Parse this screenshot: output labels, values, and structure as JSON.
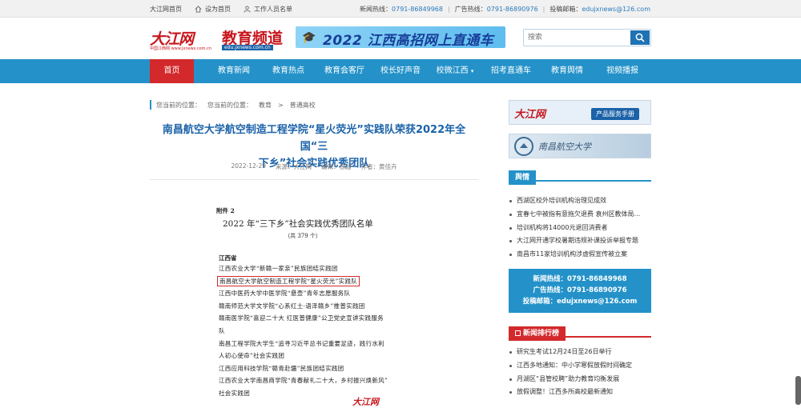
{
  "topbar": {
    "home": "大江网首页",
    "set_home": "设为首页",
    "staff": "工作人员名单",
    "news_label": "新闻热线：",
    "news_phone": "0791-86849968",
    "ad_label": "广告热线：",
    "ad_phone": "0791-86890976",
    "email_label": "投稿邮箱：",
    "email": "edujxnews@126.com"
  },
  "header": {
    "logo_text": "大江网",
    "logo_sub": "中国江西网 www.jxnews.com.cn",
    "section_logo": "教育频道",
    "section_url": "edu.jxnews.com.cn",
    "banner_text": "2022 江西高招网上直通车",
    "search_placeholder": "搜索"
  },
  "nav": {
    "items": [
      "首页",
      "教育新闻",
      "教育热点",
      "教育会客厅",
      "校长好声音",
      "校微江西",
      "招考直通车",
      "教育舆情",
      "视频播报"
    ]
  },
  "crumb": {
    "label": "您当前的位置：",
    "label2": "您当前的位置：",
    "c1": "教育",
    "arrow": ">",
    "c2": "普通高校"
  },
  "article": {
    "title_l1": "南昌航空大学航空制造工程学院“星火荧光”实践队荣获2022年全国“三",
    "title_l2": "下乡”社会实践优秀团队",
    "date": "2022-12-29",
    "source": "来源：大江网",
    "editor": "编辑：徐超",
    "author": "作者：黄佳卉"
  },
  "doc": {
    "attachment": "附件 2",
    "title": "2022 年“三下乡”社会实践优秀团队名单",
    "subtitle": "（共 379 个）",
    "province": "江西省",
    "lines": [
      "江西农业大学“新赣一家亲”民族团结实践团",
      "南昌航空大学航空制造工程学院“星火荧光”实践队",
      "江西中医药大学中医学院“悬壶”青年志愿服务队",
      "赣南师范大学文学院“心系红土·语泽赣乡”推普实践团",
      "赣南医学院“喜迎二十大 红医普健康”公卫党史宣讲实践服务",
      "队",
      "南昌工程学院大学生“追寻习近平总书记重要足迹，践行水利",
      "人初心使命”社会实践团",
      "江西应用科技学院“赣青赴疆”民族团结实践团",
      "江西农业大学南昌商学院“青春献礼二十大，乡村振兴焕新风”",
      "社会实践团"
    ],
    "watermark": "大江网"
  },
  "sidebar": {
    "ad1_logo": "大江网",
    "ad1_button": "产品服务手册",
    "ad2_text": "南昌航空大学",
    "section1": "舆情",
    "list1": [
      "西湖区校外培训机构治理见成效",
      "宜春七中被指有意拖欠退费 袁州区教体局...",
      "培训机构将14000元退回消费者",
      "大江网开通学校暑期违规补课投诉举报专题",
      "南昌市11家培训机构涉虚假宣传被立案"
    ],
    "hot_news": "新闻热线：0791-86849968",
    "hot_ad": "广告热线：0791-86890976",
    "hot_email": "投稿邮箱：edujxnews@126.com",
    "section2": "新闻排行榜",
    "list2": [
      "研究生考试12月24日至26日举行",
      "江西多地通知：中小学寒假放假时间确定",
      "月湖区“县管校聘”助力教育均衡发展",
      "放假调整！江西多所高校最新通知"
    ]
  }
}
